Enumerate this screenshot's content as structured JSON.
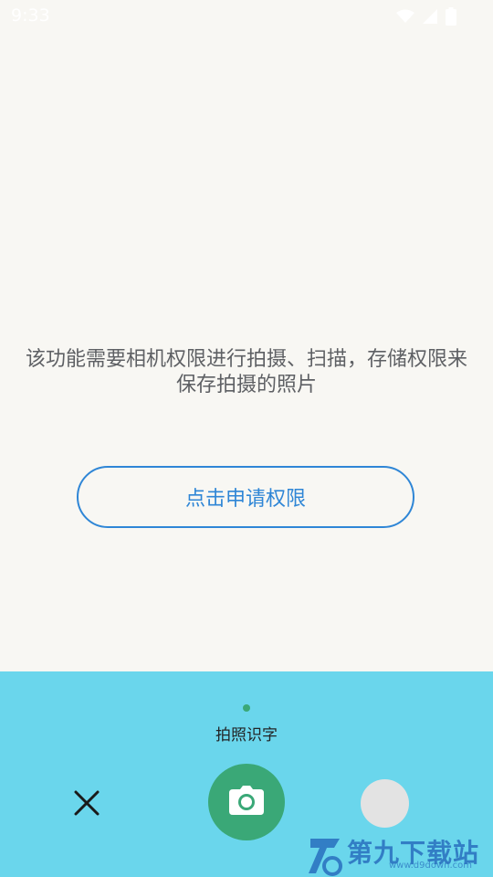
{
  "status_bar": {
    "time": "9:33",
    "icons": [
      "wifi-icon",
      "signal-icon",
      "battery-icon"
    ]
  },
  "permission": {
    "message": "该功能需要相机权限进行拍摄、扫描，存储权限来保存拍摄的照片",
    "button_label": "点击申请权限"
  },
  "bottom_bar": {
    "mode_label": "拍照识字",
    "close_icon": "close-icon",
    "shutter_icon": "camera-icon",
    "gallery_icon": "gallery-thumbnail"
  },
  "watermark": {
    "text": "第九下载站",
    "url": "www.d9down.com"
  },
  "colors": {
    "background": "#f8f7f3",
    "panel": "#6ad6ec",
    "accent_green": "#3aa877",
    "link_blue": "#2f86d6",
    "message_gray": "#5e6064"
  }
}
